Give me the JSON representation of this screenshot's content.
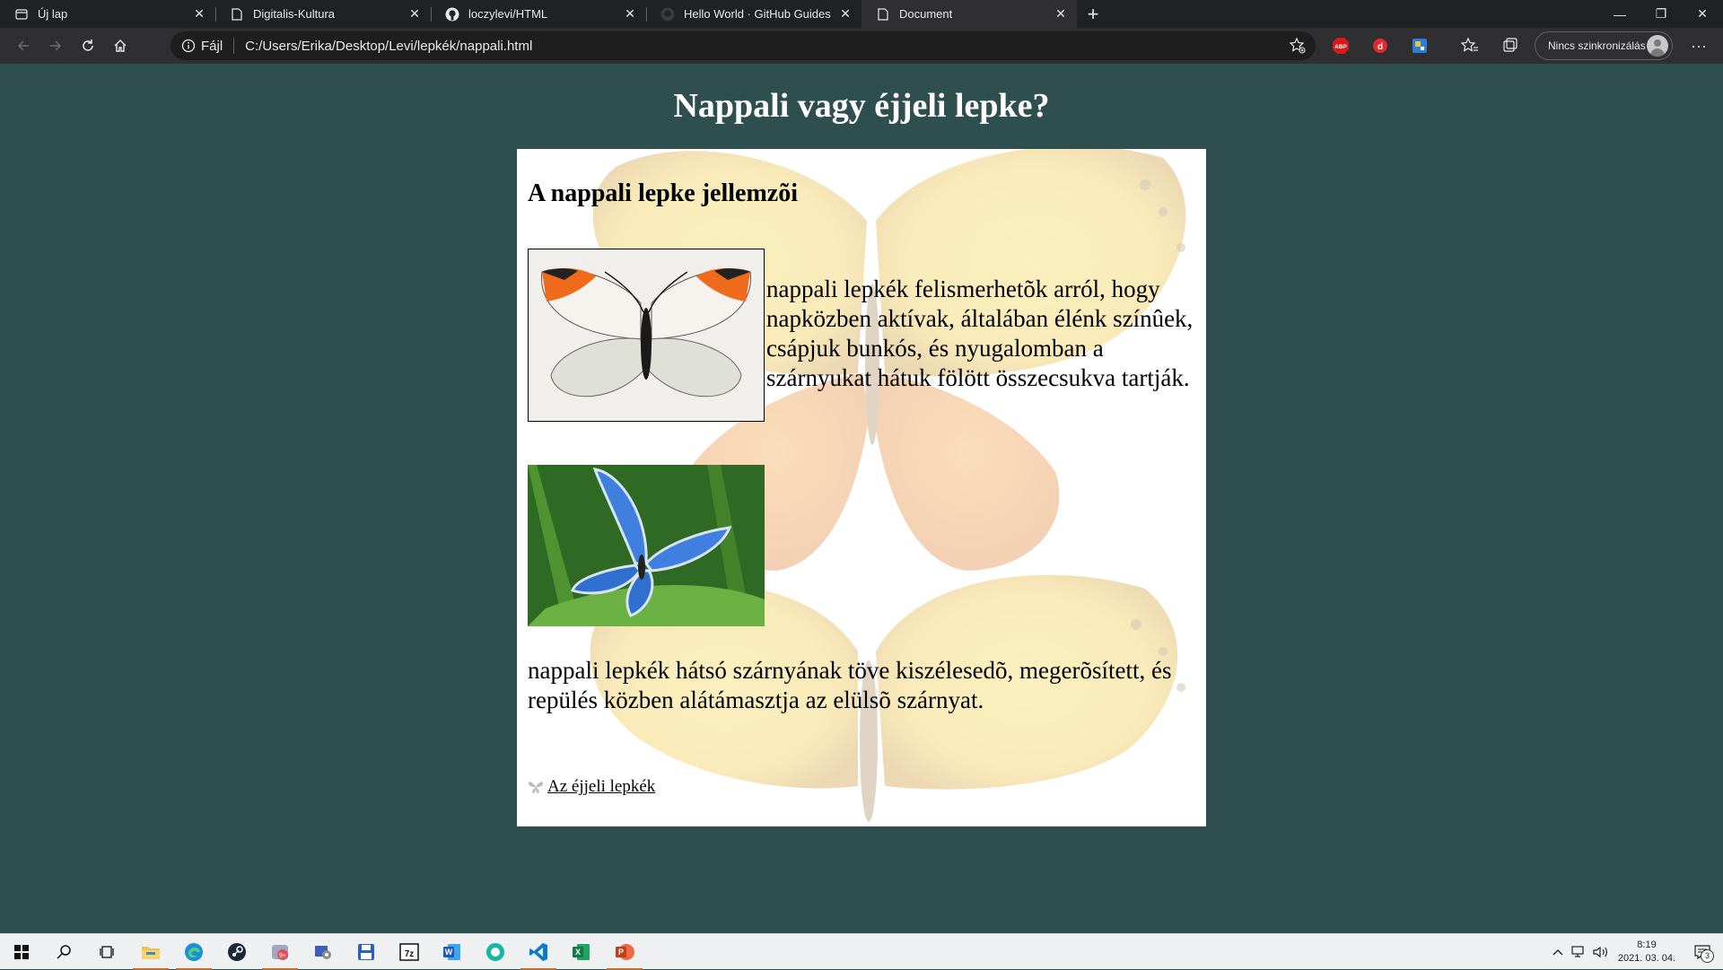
{
  "tabs": [
    {
      "title": "Új lap",
      "icon": "new-tab-icon",
      "active": false
    },
    {
      "title": "Digitalis-Kultura",
      "icon": "page-icon",
      "active": false
    },
    {
      "title": "loczylevi/HTML",
      "icon": "github-icon",
      "active": false
    },
    {
      "title": "Hello World · GitHub Guides",
      "icon": "github-icon",
      "active": false
    },
    {
      "title": "Document",
      "icon": "page-icon",
      "active": true
    }
  ],
  "address": {
    "protocol_label": "Fájl",
    "url": "C:/Users/Erika/Desktop/Levi/lepkék/nappali.html"
  },
  "extensions": [
    {
      "name": "favorites-add-icon"
    },
    {
      "name": "adblock-icon",
      "label": "ABP"
    },
    {
      "name": "ext-red-icon"
    },
    {
      "name": "ext-blue-icon"
    },
    {
      "name": "favorites-icon"
    },
    {
      "name": "collections-icon"
    }
  ],
  "profile": {
    "label": "Nincs szinkronizálás"
  },
  "page": {
    "title": "Nappali vagy éjjeli lepke?",
    "heading": "A nappali lepke jellemzõi",
    "paragraph1": "nappali lepkék felismerhetõk arról, hogy napközben aktívak, általában élénk színûek, csápjuk bunkós, és nyugalomban a szárnyukat hátuk fölött összecsukva tartják.",
    "paragraph2": "nappali lepkék hátsó szárnyának töve kiszélesedõ, megerõsített, és repülés közben alátámasztja az elülsõ szárnyat.",
    "link_text": "Az éjjeli lepkék"
  },
  "taskbar": {
    "apps": [
      "start",
      "search",
      "task-view",
      "file-explorer",
      "edge",
      "steam",
      "app-red",
      "app-people",
      "floppy-save",
      "7zip",
      "word",
      "app-green",
      "vscode",
      "excel",
      "powerpoint"
    ],
    "time": "8:19",
    "date": "2021. 03. 04.",
    "notifications": "3"
  },
  "colors": {
    "page_background": "#2f4f4f",
    "panel_background": "#ffffff",
    "browser_chrome": "#202124"
  }
}
